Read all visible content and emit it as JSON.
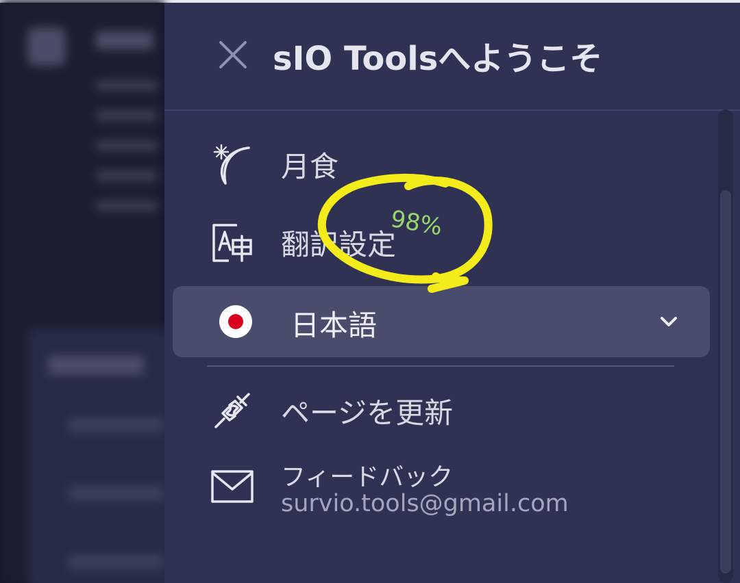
{
  "drawer": {
    "title": "sIO Toolsへようこそ",
    "close_icon": "close-icon"
  },
  "menu": {
    "eclipse": {
      "label": "月食",
      "icon": "eclipse-moon-icon"
    },
    "translation": {
      "label": "翻訳設定",
      "icon": "translate-icon"
    },
    "language": {
      "label": "日本語",
      "icon": "japan-flag-icon",
      "chevron": "chevron-down-icon"
    },
    "reload": {
      "label": "ページを更新",
      "icon": "plug-icon"
    },
    "feedback": {
      "label": "フィードバック",
      "email": "survio.tools@gmail.com",
      "icon": "mail-icon"
    }
  },
  "annotation": {
    "text": "98%",
    "circle_color": "#f3ec1a",
    "text_color": "#9ad46b"
  },
  "colors": {
    "drawer_bg": "#2f3253",
    "select_bg": "#4a4c6c",
    "text": "#d8d9e4",
    "flag_red": "#d7001e"
  }
}
